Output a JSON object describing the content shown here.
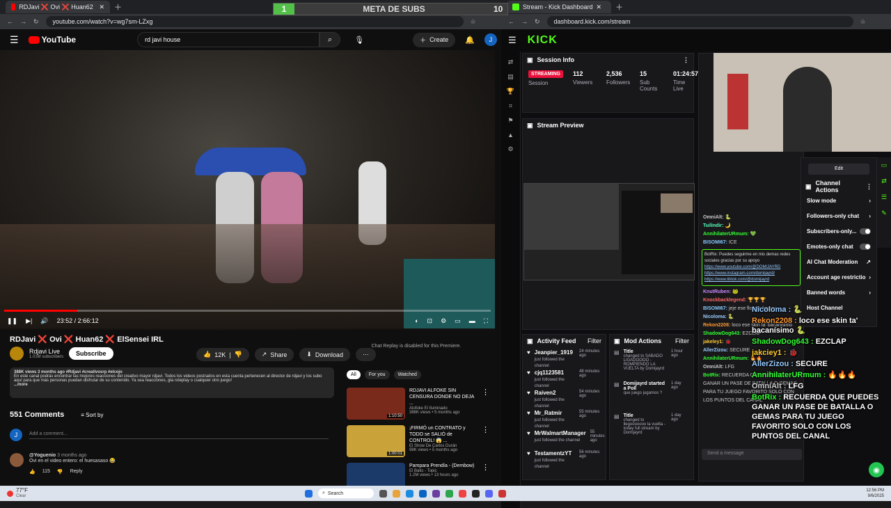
{
  "youtube": {
    "tab_title": "RDJavi ❌ Ovi ❌ Huan62 ❌ ElSensei IRL",
    "url": "youtube.com/watch?v=wg7sm-LZxg",
    "search_value": "rd javi house",
    "create_label": "Create",
    "avatar_letter": "J",
    "time": "23:52 / 2:66:12",
    "title": "RDJavi ❌ Ovi ❌ Huan62 ❌ ElSensei IRL",
    "channel": "Rdjavi Live",
    "subs": "1.01M subscribers",
    "subscribe": "Subscribe",
    "likes": "12K",
    "share": "Share",
    "download": "Download",
    "chat_replay": "Chat Replay is disabled for this Premiere.",
    "meta": "388K views  3 months ago  #Rdjavi #creativosrp #elcojo",
    "description": "En este canal podrás encontrar las mejores reacciones del creativo mayor rdjavi. Todos los videos postrados en esta cuenta pertenecen al director de rdjavi y los subo aquí para que más personas puedan disfrutar de su contenido. Ya sea reacciones, gta roleplay o cualquier otro juego!",
    "more": "...more",
    "comments_count": "551 Comments",
    "sort_by": "Sort by",
    "add_comment": "Add a comment...",
    "comment_user": "@Yoguenio",
    "comment_time": "3 months ago",
    "comment_text": "Ovi en el video entero: el huesasaso 😂",
    "comment_likes": "115",
    "reply": "Reply",
    "filters": [
      "All",
      "For you",
      "Watched"
    ],
    "recs": [
      {
        "title": "RDJAVI ALFOKE SIN CENSURA DONDE NO DEJA ...",
        "channel": "Alofoke El Iluminado",
        "meta": "386K views • 5 months ago",
        "dur": "1:10:50",
        "color": "#7a2a1a"
      },
      {
        "title": "¡FIRMÓ un CONTRATO y TODO se SALIÓ de CONTROL! 😱 ...",
        "channel": "El Show De Carlos Durán",
        "meta": "98K views • 5 months ago",
        "dur": "1:00:01",
        "color": "#c9a23a"
      },
      {
        "title": "Pampara Prendía - (Dembow)",
        "channel": "El Batis - Topic",
        "meta": "1.2M views • 13 hours ago",
        "dur": "",
        "color": "#1b3a6a"
      }
    ]
  },
  "kick": {
    "tab_title": "Stream - Kick Dashboard",
    "url": "dashboard.kick.com/stream",
    "logo": "KICK",
    "meta_subs": "META DE SUBS",
    "meta_left": "1",
    "meta_right": "10",
    "session_info": "Session Info",
    "streaming": "STREAMING",
    "session": "Session",
    "stats": [
      {
        "value": "112",
        "label": "Viewers"
      },
      {
        "value": "2,536",
        "label": "Followers"
      },
      {
        "value": "15",
        "label": "Sub Counts"
      },
      {
        "value": "01:24:57",
        "label": "Time Live"
      }
    ],
    "stream_preview": "Stream Preview",
    "activity_feed": "Activity Feed",
    "mod_actions": "Mod Actions",
    "filter": "Filter",
    "activity": [
      {
        "name": "Jeanpier_1919",
        "sub": "just followed the channel",
        "time": "24 minutes ago"
      },
      {
        "name": "cjq1123581",
        "sub": "just followed the channel",
        "time": "48 minutes ago"
      },
      {
        "name": "Raiven2",
        "sub": "just followed the channel",
        "time": "54 minutes ago"
      },
      {
        "name": "Mr_Ratmir",
        "sub": "just followed the channel",
        "time": "55 minutes ago"
      },
      {
        "name": "MrWalmartManager",
        "sub": "just followed the channel",
        "time": "55 minutes ago"
      },
      {
        "name": "TestamentzYT",
        "sub": "just followed the channel",
        "time": "56 minutes ago"
      }
    ],
    "mod": [
      {
        "name": "Title",
        "sub": "changed to SABADO LIGADOOOO - ROMPIENDO LA VUELTA by Domijayrd",
        "time": "1 hour ago"
      },
      {
        "name": "Domijayrd started a Poll",
        "sub": "que juego jugamos ?",
        "time": "1 day ago"
      },
      {
        "name": "Title",
        "sub": "changed to llegooooooo la vuelta - today full stream by Domijayrd",
        "time": "1 day ago"
      }
    ],
    "chat": [
      {
        "user": "OmniAlt:",
        "text": "🐍",
        "color": "#ccc"
      },
      {
        "user": "Tuilindir:",
        "text": "🌙",
        "color": "#5fb"
      },
      {
        "user": "AnnihilaterURmum:",
        "text": "💚",
        "color": "#3f3"
      },
      {
        "user": "BISOMI67:",
        "text": "ICE",
        "color": "#8cf"
      }
    ],
    "botrix_msg": "BotRix: Puedes seguirme en mis demas redes sociales gracias por su apoyo",
    "links": [
      "https://www.youtube.com/@DOMIJAYRD",
      "https://www.instagram.com/domijayrd/",
      "https://www.tiktok.com/@domijayrd"
    ],
    "chat2": [
      {
        "user": "KnutRuben:",
        "text": "🐸",
        "color": "#c8f"
      },
      {
        "user": "Knockbacklegend:",
        "text": "🏆🏆🏆",
        "color": "#f66"
      },
      {
        "user": "BISOMI67:",
        "text": "jeje ese flow ta heavy",
        "color": "#8cf"
      },
      {
        "user": "Nicoloma:",
        "text": "🐍",
        "color": "#9cf"
      },
      {
        "user": "Rekon2208:",
        "text": "loco ese skin ta' bacanisimo",
        "color": "#f93"
      },
      {
        "user": "ShadowDog643:",
        "text": "EZCLAP",
        "color": "#3f3"
      },
      {
        "user": "jakeley1:",
        "text": "🐞",
        "color": "#fc3"
      },
      {
        "user": "AllerZizou:",
        "text": "SECURE",
        "color": "#9cf"
      },
      {
        "user": "AnnihilaterURmum:",
        "text": "🔥🔥",
        "color": "#3f3"
      },
      {
        "user": "OmniAlt:",
        "text": "LFG",
        "color": "#ccc"
      },
      {
        "user": "BotRix:",
        "text": "RECUERDA QUE PUEDES GANAR UN PASE DE BATALLA O GEMAS PARA TU JUEGO FAVORITO SOLO CON LOS PUNTOS DEL CANAL",
        "color": "#3f3"
      }
    ],
    "send_message": "Send a message",
    "edit": "Edit",
    "channel_actions": "Channel Actions",
    "actions": [
      {
        "label": "Slow mode",
        "kind": "arrow"
      },
      {
        "label": "Followers-only chat",
        "kind": "arrow"
      },
      {
        "label": "Subscribers-only...",
        "kind": "toggle"
      },
      {
        "label": "Emotes-only chat",
        "kind": "toggle"
      },
      {
        "label": "AI Chat Moderation",
        "kind": "link"
      },
      {
        "label": "Account age restrictio",
        "kind": "arrow"
      },
      {
        "label": "Banned words",
        "kind": "arrow"
      },
      {
        "label": "Host Channel",
        "kind": "none"
      }
    ],
    "overlay_chat": [
      {
        "user": "Nicoloma :",
        "text": "🐍",
        "color": "#9cf"
      },
      {
        "user": "Rekon2208 :",
        "text": "loco ese skin ta' bacanísimo 🐍",
        "color": "#f93"
      },
      {
        "user": "ShadowDog643 :",
        "text": "EZCLAP",
        "color": "#3f3"
      },
      {
        "user": "jakciey1 :",
        "text": "🐞",
        "color": "#fc3"
      },
      {
        "user": "AllerZizou :",
        "text": "SECURE",
        "color": "#9cf"
      },
      {
        "user": "AnnihilaterURmum :",
        "text": "🔥🔥🔥",
        "color": "#3f3"
      },
      {
        "user": "OmniAlt :",
        "text": "LFG",
        "color": "#ccc"
      },
      {
        "user": "BotRix :",
        "text": "RECUERDA QUE PUEDES GANAR UN PASE DE BATALLA O GEMAS PARA TU JUEGO FAVORITO SOLO CON LOS PUNTOS DEL CANAL",
        "color": "#3f3"
      }
    ]
  },
  "taskbar": {
    "weather": "77°F",
    "weather_sub": "Clear",
    "search": "Search",
    "time": "12:56 PM",
    "date": "9/6/2025"
  }
}
